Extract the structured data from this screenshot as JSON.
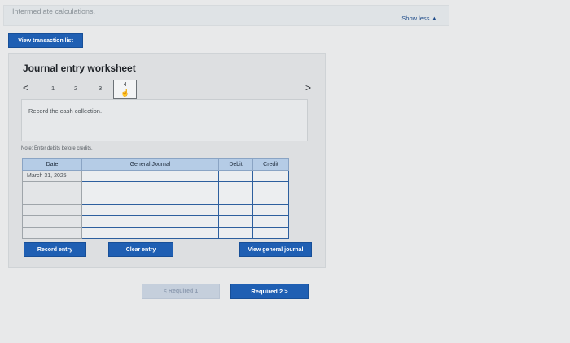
{
  "header": {
    "title": "Intermediate calculations.",
    "show_less": "Show less ▲"
  },
  "view_transaction_list": "View transaction list",
  "worksheet": {
    "title": "Journal entry worksheet",
    "prev_arrow": "<",
    "next_arrow": ">",
    "pages": [
      "1",
      "2",
      "3",
      "4"
    ],
    "active_page": "4",
    "instruction": "Record the cash collection.",
    "note": "Note: Enter debits before credits.",
    "columns": {
      "date": "Date",
      "general_journal": "General Journal",
      "debit": "Debit",
      "credit": "Credit"
    },
    "rows": [
      {
        "date": "March 31, 2025",
        "account": "",
        "debit": "",
        "credit": ""
      },
      {
        "date": "",
        "account": "",
        "debit": "",
        "credit": ""
      },
      {
        "date": "",
        "account": "",
        "debit": "",
        "credit": ""
      },
      {
        "date": "",
        "account": "",
        "debit": "",
        "credit": ""
      },
      {
        "date": "",
        "account": "",
        "debit": "",
        "credit": ""
      },
      {
        "date": "",
        "account": "",
        "debit": "",
        "credit": ""
      }
    ],
    "record_entry": "Record entry",
    "clear_entry": "Clear entry",
    "view_general_journal": "View general journal"
  },
  "footer": {
    "prev_required": "< Required 1",
    "next_required": "Required 2 >"
  },
  "colors": {
    "primary_blue": "#1f5fb3",
    "header_blue": "#b5cce6"
  }
}
